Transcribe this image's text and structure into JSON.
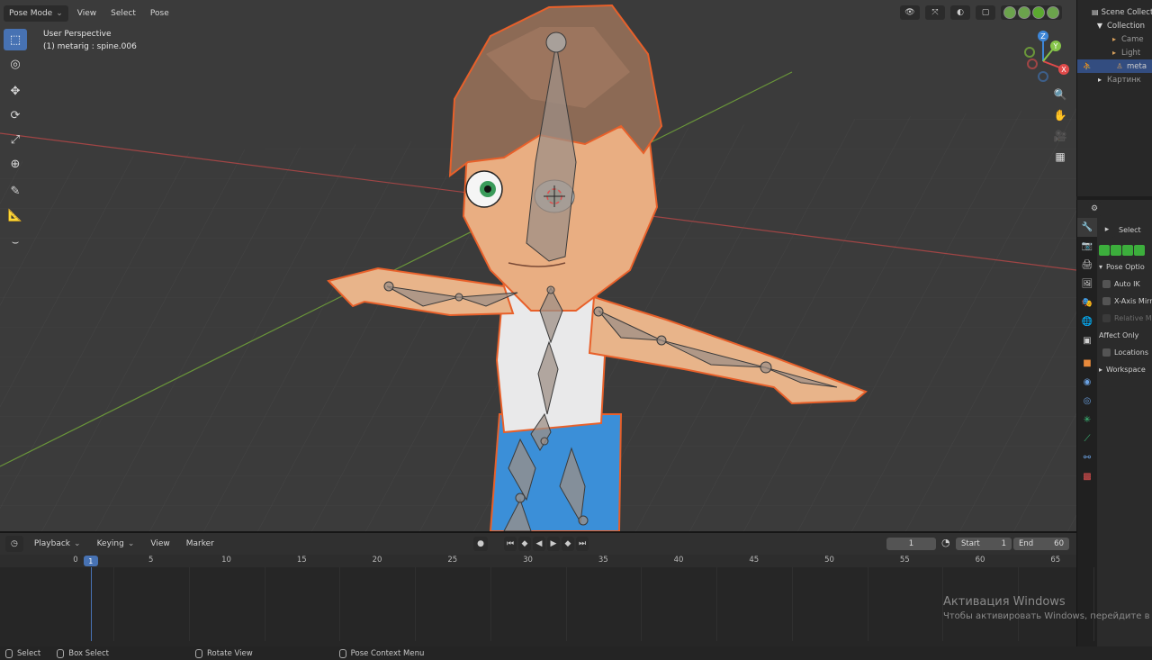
{
  "header": {
    "mode_label": "Pose Mode",
    "menus": [
      "View",
      "Select",
      "Pose"
    ]
  },
  "viewport": {
    "view_name": "User Perspective",
    "active_bone": "(1) metarig : spine.006"
  },
  "toolbar": {
    "tools": [
      "select-box-icon",
      "cursor-icon",
      "move-icon",
      "rotate-icon",
      "scale-icon",
      "transform-icon",
      "annotate-icon",
      "measure-icon",
      "relax-icon"
    ]
  },
  "gizmo": {
    "axes": [
      "X",
      "Y",
      "Z"
    ]
  },
  "outliner": {
    "rows": [
      {
        "label": "Scene Collect",
        "indent": 0,
        "icon": "collection-icon",
        "selected": false
      },
      {
        "label": "Collection",
        "indent": 1,
        "icon": "collection-icon",
        "selected": false
      },
      {
        "label": "Came",
        "indent": 2,
        "icon": "camera-icon",
        "selected": false
      },
      {
        "label": "Light",
        "indent": 2,
        "icon": "light-icon",
        "selected": false
      },
      {
        "label": "meta",
        "indent": 2,
        "icon": "armature-icon",
        "selected": true
      },
      {
        "label": "Картинк",
        "indent": 1,
        "icon": "collection-icon",
        "selected": false
      }
    ]
  },
  "properties": {
    "select_label": "Select",
    "pose_options_label": "Pose Optio",
    "auto_ik": "Auto IK",
    "x_axis_mirror": "X-Axis Mirro",
    "relative_mirror": "Relative Mi",
    "affect_only": "Affect Only",
    "locations": "Locations",
    "workspace": "Workspace"
  },
  "timeline": {
    "menus": [
      "Playback",
      "Keying",
      "View",
      "Marker"
    ],
    "current_frame": "1",
    "start_label": "Start",
    "start_value": "1",
    "end_label": "End",
    "end_value": "60",
    "ticks": [
      "0",
      "5",
      "10",
      "15",
      "20",
      "25",
      "30",
      "35",
      "40",
      "45",
      "50",
      "55",
      "60",
      "65"
    ],
    "frame_indicator": "1"
  },
  "statusbar": {
    "select": "Select",
    "box_select": "Box Select",
    "rotate_view": "Rotate View",
    "pose_context_menu": "Pose Context Menu"
  },
  "watermark": {
    "line1": "Активация Windows",
    "line2": "Чтобы активировать Windows, перейдите в"
  },
  "colors": {
    "accent": "#4772b3",
    "selection_outline": "#e8602a",
    "axis_x": "#e04a4a",
    "axis_y": "#86c54a",
    "axis_z": "#3d86d8"
  }
}
